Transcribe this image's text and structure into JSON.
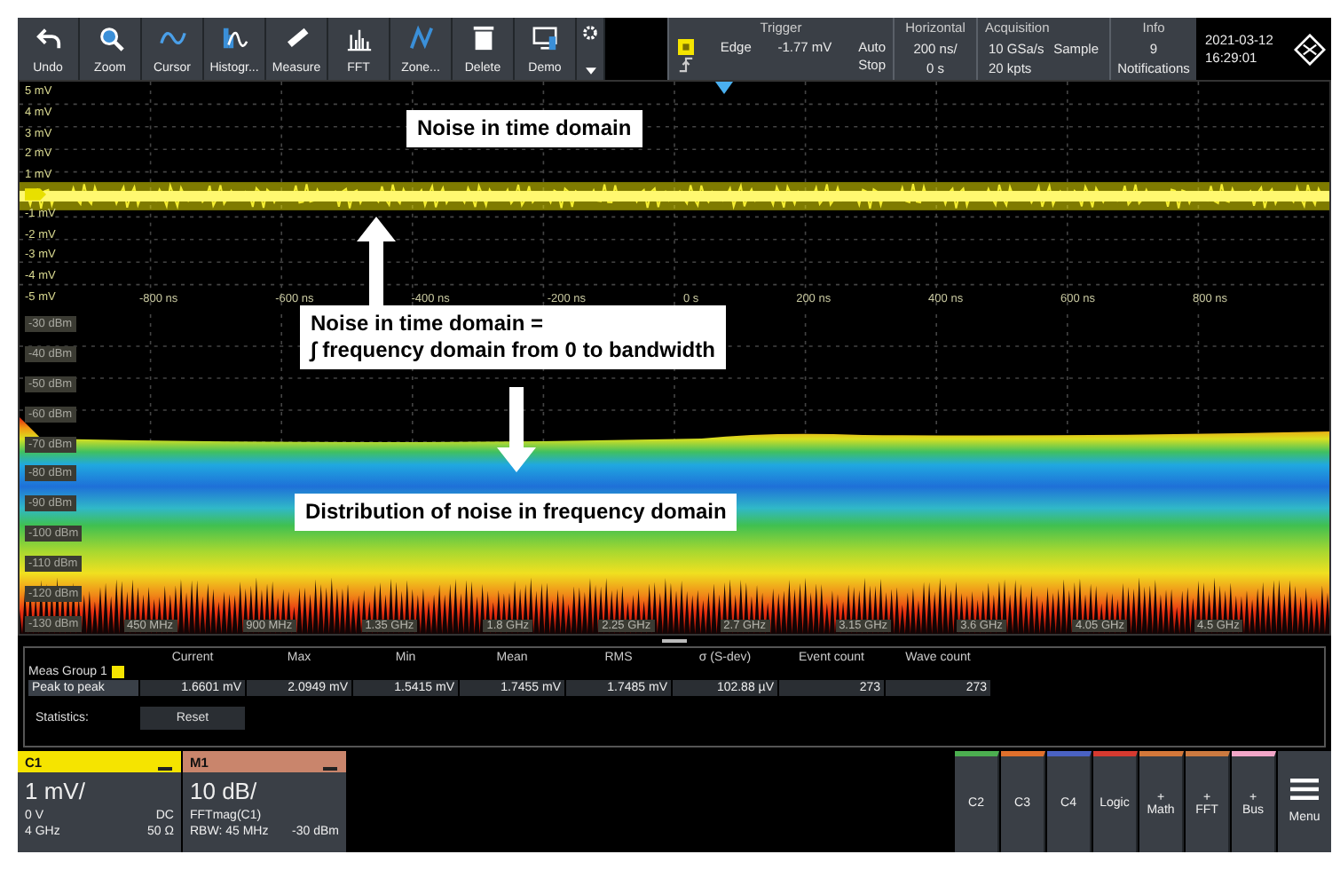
{
  "toolbar": {
    "buttons": [
      {
        "label": "Undo"
      },
      {
        "label": "Zoom"
      },
      {
        "label": "Cursor"
      },
      {
        "label": "Histogr..."
      },
      {
        "label": "Measure"
      },
      {
        "label": "FFT"
      },
      {
        "label": "Zone..."
      },
      {
        "label": "Delete"
      },
      {
        "label": "Demo"
      }
    ]
  },
  "status": {
    "trigger": {
      "title": "Trigger",
      "type": "Edge",
      "level": "-1.77 mV",
      "mode": "Auto",
      "state": "Stop"
    },
    "horizontal": {
      "title": "Horizontal",
      "scale": "200 ns/",
      "position": "0 s"
    },
    "acquisition": {
      "title": "Acquisition",
      "rate": "10 GSa/s",
      "mode": "Sample",
      "length": "20 kpts"
    },
    "info": {
      "title": "Info",
      "count": "9",
      "label": "Notifications"
    },
    "date": "2021-03-12",
    "time": "16:29:01"
  },
  "time_plot": {
    "y_labels": [
      "5 mV",
      "4 mV",
      "3 mV",
      "2 mV",
      "1 mV",
      "-1 mV",
      "-2 mV",
      "-3 mV",
      "-4 mV",
      "-5 mV"
    ],
    "x_labels": [
      "-800 ns",
      "-600 ns",
      "-400 ns",
      "-200 ns",
      "0 s",
      "200 ns",
      "400 ns",
      "600 ns",
      "800 ns"
    ]
  },
  "spectrum_plot": {
    "y_labels": [
      "-30 dBm",
      "-40 dBm",
      "-50 dBm",
      "-60 dBm",
      "-70 dBm",
      "-80 dBm",
      "-90 dBm",
      "-100 dBm",
      "-110 dBm",
      "-120 dBm",
      "-130 dBm"
    ],
    "x_labels": [
      "450 MHz",
      "900 MHz",
      "1.35 GHz",
      "1.8 GHz",
      "2.25 GHz",
      "2.7 GHz",
      "3.15 GHz",
      "3.6 GHz",
      "4.05 GHz",
      "4.5 GHz"
    ]
  },
  "annotations": [
    "Noise in time domain",
    "Noise in time domain =\n∫ frequency domain from 0 to bandwidth",
    "Distribution of noise in frequency domain"
  ],
  "measurements": {
    "columns": [
      "Current",
      "Max",
      "Min",
      "Mean",
      "RMS",
      "σ (S-dev)",
      "Event count",
      "Wave count"
    ],
    "group": "Meas Group 1",
    "rows": [
      {
        "label": "Peak to peak",
        "values": [
          "1.6601 mV",
          "2.0949 mV",
          "1.5415 mV",
          "1.7455 mV",
          "1.7485 mV",
          "102.88 µV",
          "273",
          "273"
        ]
      }
    ],
    "statistics": "Statistics:",
    "reset": "Reset"
  },
  "channels": [
    {
      "name": "C1",
      "color": "#f5e400",
      "scale": "1 mV/",
      "lines": [
        {
          "left": "0 V",
          "right": "DC"
        },
        {
          "left": "4 GHz",
          "right": "50 Ω"
        }
      ]
    },
    {
      "name": "M1",
      "color": "#c9856c",
      "scale": "10 dB/",
      "lines": [
        {
          "left": "FFTmag(C1)"
        },
        {
          "left": "RBW: 45 MHz",
          "right": "-30 dBm"
        }
      ]
    }
  ],
  "sources": [
    {
      "label": "C2",
      "color": "#4caf50"
    },
    {
      "label": "C3",
      "color": "#e0702c"
    },
    {
      "label": "C4",
      "color": "#4a62c4"
    },
    {
      "label": "Logic",
      "color": "#d63a30"
    },
    {
      "prefix": "+",
      "label": "Math",
      "color": "#d4783a"
    },
    {
      "prefix": "+",
      "label": "FFT",
      "color": "#cc7a40"
    },
    {
      "prefix": "+",
      "label": "Bus",
      "color": "#f2a6c8"
    }
  ],
  "menu": "Menu"
}
